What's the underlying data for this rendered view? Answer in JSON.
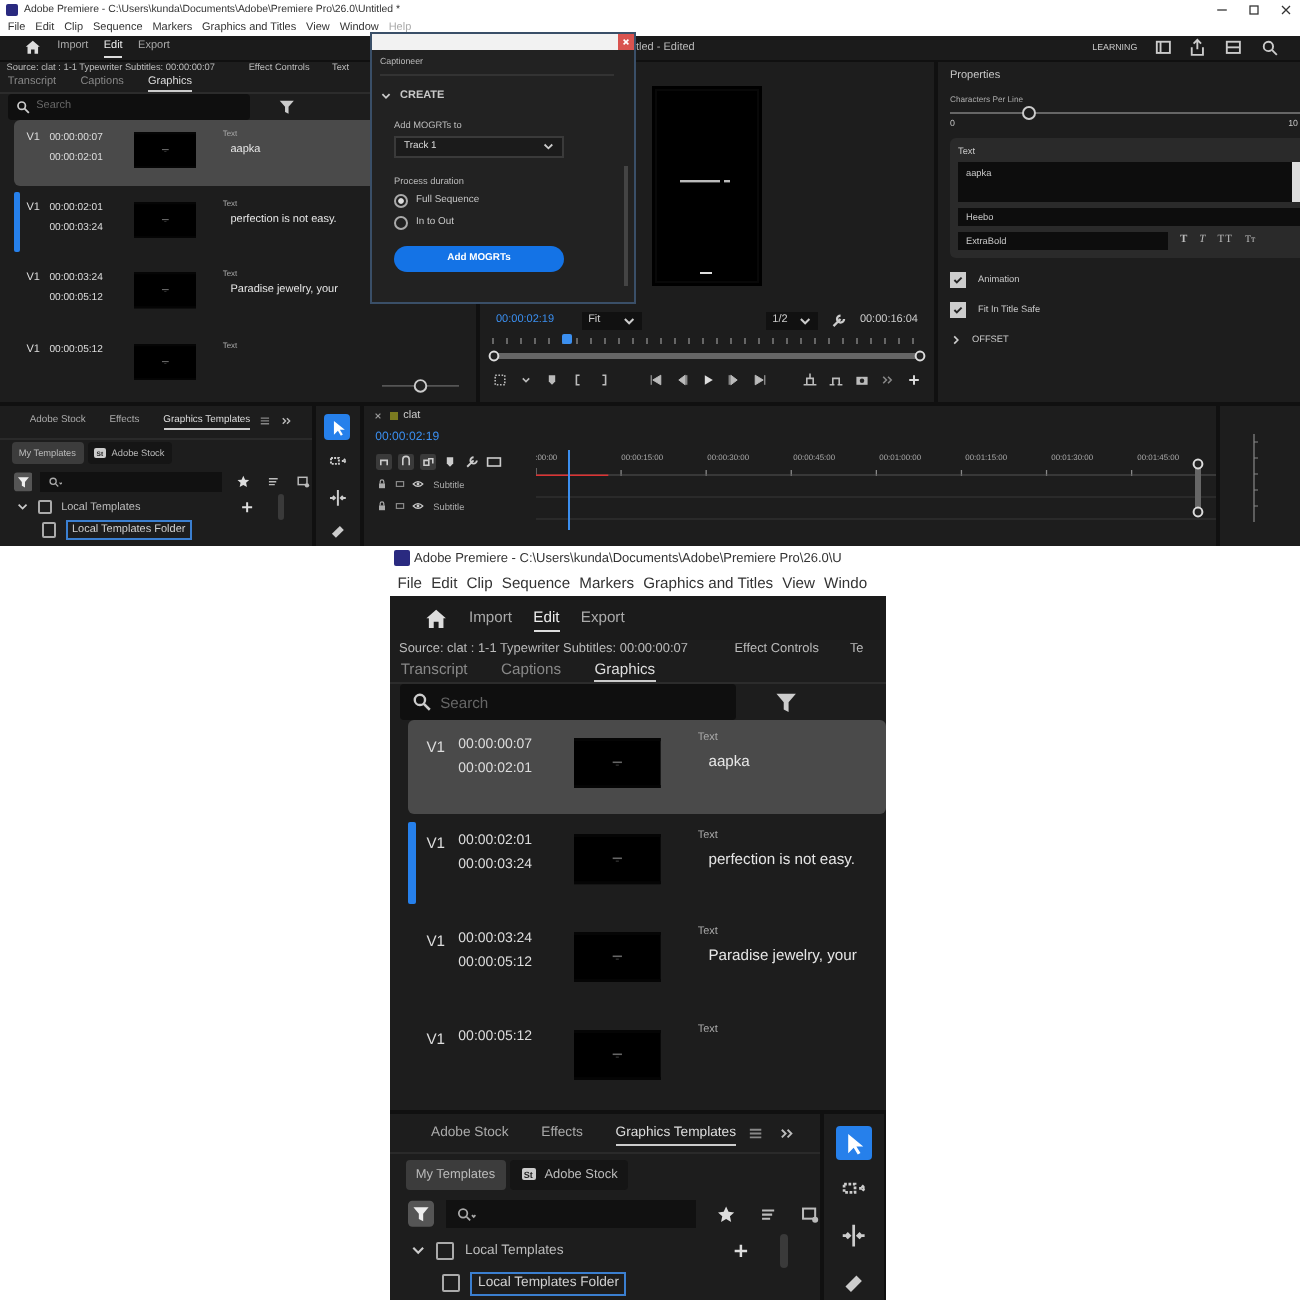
{
  "full_window": {
    "title": "Adobe Premiere - C:\\Users\\kunda\\Documents\\Adobe\\Premiere Pro\\26.0\\Untitled *",
    "menu": [
      "File",
      "Edit",
      "Clip",
      "Sequence",
      "Markers",
      "Graphics and Titles",
      "View",
      "Window",
      "Help"
    ],
    "workspace_tabs": [
      {
        "label": "Import",
        "selected": false
      },
      {
        "label": "Edit",
        "selected": true
      },
      {
        "label": "Export",
        "selected": false
      }
    ],
    "project_title": "tled - Edited",
    "learning": "LEARNING",
    "graphics_panel": {
      "source": "Source: clat : 1-1 Typewriter Subtitles: 00:00:00:07",
      "effect_controls": "Effect Controls",
      "next_tab": "Text",
      "tabs": [
        {
          "label": "Transcript",
          "selected": false
        },
        {
          "label": "Captions",
          "selected": false
        },
        {
          "label": "Graphics",
          "selected": true
        }
      ],
      "search": {
        "placeholder": "Search"
      },
      "items": [
        {
          "track": "V1",
          "start": "00:00:00:07",
          "end": "00:00:02:01",
          "type": "Text",
          "text": "aapka",
          "selected": true,
          "current": false
        },
        {
          "track": "V1",
          "start": "00:00:02:01",
          "end": "00:00:03:24",
          "type": "Text",
          "text": "perfection is not easy.",
          "selected": false,
          "current": true
        },
        {
          "track": "V1",
          "start": "00:00:03:24",
          "end": "00:00:05:12",
          "type": "Text",
          "text": "Paradise jewelry, your",
          "selected": false,
          "current": false
        },
        {
          "track": "V1",
          "start": "00:00:05:12",
          "type": "Text",
          "selected": false,
          "current": false
        }
      ],
      "zoom_slider": {
        "level": 0.5
      }
    },
    "captioneer": {
      "title": "Captioneer",
      "section": "CREATE",
      "target_label": "Add MOGRTs to",
      "target": "Track 1",
      "duration_label": "Process duration",
      "options": [
        {
          "label": "Full Sequence",
          "selected": true
        },
        {
          "label": "In to Out",
          "selected": false
        }
      ],
      "button": "Add MOGRTs"
    },
    "program_monitor": {
      "timecode": "00:00:02:19",
      "zoom": "Fit",
      "resolution": "1/2",
      "duration": "00:00:16:04",
      "level": 0.17
    },
    "properties": {
      "title": "Properties",
      "slider": {
        "label": "Characters Per Line",
        "level": 0.22,
        "min": "0",
        "max": "10"
      },
      "text_section": {
        "title": "Text",
        "value": "aapka",
        "font": "Heebo",
        "style": "ExtraBold",
        "style_buttons": [
          {
            "label": "T",
            "kind": "bold"
          },
          {
            "label": "T",
            "kind": "italic"
          },
          {
            "label": "TT",
            "kind": "caps"
          },
          {
            "label": "Tт",
            "kind": "small"
          }
        ]
      },
      "checkboxes": [
        {
          "label": "Animation",
          "checked": true
        },
        {
          "label": "Fit In Title Safe",
          "checked": true
        }
      ],
      "offset": {
        "label": "OFFSET",
        "expanded": false
      }
    },
    "templates_panel": {
      "tabs": [
        {
          "label": "Adobe Stock",
          "selected": false
        },
        {
          "label": "Effects",
          "selected": false
        },
        {
          "label": "Graphics Templates",
          "selected": true
        }
      ],
      "sources": [
        {
          "label": "My Templates",
          "selected": true
        },
        {
          "label": "Adobe Stock",
          "selected": false,
          "badge": "St"
        }
      ],
      "tree": [
        {
          "label": "Local Templates",
          "expanded": true,
          "checked": false,
          "children": [
            {
              "label": "Local Templates Folder",
              "checked": false,
              "selected": true
            }
          ]
        }
      ]
    },
    "tools": [
      {
        "kind": "select",
        "selected": true
      },
      {
        "kind": "track",
        "selected": false
      },
      {
        "kind": "ripple",
        "selected": false
      },
      {
        "kind": "razor",
        "selected": false
      }
    ],
    "timeline": {
      "sequence": "clat",
      "timecode": "00:00:02:19",
      "ruler": [
        ":00:00",
        "00:00:15:00",
        "00:00:30:00",
        "00:00:45:00",
        "00:01:00:00",
        "00:01:15:00",
        "00:01:30:00",
        "00:01:45:00"
      ],
      "tracks": [
        "Subtitle",
        "Subtitle"
      ],
      "level": 0.03
    }
  },
  "zoomed_inset": {
    "title": "Adobe Premiere - C:\\Users\\kunda\\Documents\\Adobe\\Premiere Pro\\26.0\\U",
    "menu": [
      "File",
      "Edit",
      "Clip",
      "Sequence",
      "Markers",
      "Graphics and Titles",
      "View",
      "Windo"
    ],
    "workspace_tabs": [
      {
        "label": "Import",
        "selected": false
      },
      {
        "label": "Edit",
        "selected": true
      },
      {
        "label": "Export",
        "selected": false
      }
    ],
    "graphics_panel": {
      "source": "Source: clat : 1-1 Typewriter Subtitles: 00:00:00:07",
      "effect_controls": "Effect Controls",
      "next_tab": "Te",
      "tabs": [
        {
          "label": "Transcript",
          "selected": false
        },
        {
          "label": "Captions",
          "selected": false
        },
        {
          "label": "Graphics",
          "selected": true
        }
      ],
      "search": {
        "placeholder": "Search"
      },
      "items": [
        {
          "track": "V1",
          "start": "00:00:00:07",
          "end": "00:00:02:01",
          "type": "Text",
          "text": "aapka",
          "selected": true,
          "current": false
        },
        {
          "track": "V1",
          "start": "00:00:02:01",
          "end": "00:00:03:24",
          "type": "Text",
          "text": "perfection is not easy.",
          "selected": false,
          "current": true
        },
        {
          "track": "V1",
          "start": "00:00:03:24",
          "end": "00:00:05:12",
          "type": "Text",
          "text": "Paradise jewelry, your",
          "selected": false,
          "current": false
        },
        {
          "track": "V1",
          "start": "00:00:05:12",
          "type": "Text",
          "selected": false,
          "current": false
        }
      ]
    },
    "templates_panel": {
      "tabs": [
        {
          "label": "Adobe Stock",
          "selected": false
        },
        {
          "label": "Effects",
          "selected": false
        },
        {
          "label": "Graphics Templates",
          "selected": true
        }
      ],
      "sources": [
        {
          "label": "My Templates",
          "selected": true
        },
        {
          "label": "Adobe Stock",
          "selected": false,
          "badge": "St"
        }
      ],
      "tree": [
        {
          "label": "Local Templates",
          "expanded": true,
          "checked": false,
          "children": [
            {
              "label": "Local Templates Folder",
              "checked": false,
              "selected": true
            }
          ]
        }
      ]
    },
    "tools": [
      {
        "kind": "select",
        "selected": true
      },
      {
        "kind": "track",
        "selected": false
      },
      {
        "kind": "ripple",
        "selected": false
      },
      {
        "kind": "razor",
        "selected": false
      }
    ]
  }
}
